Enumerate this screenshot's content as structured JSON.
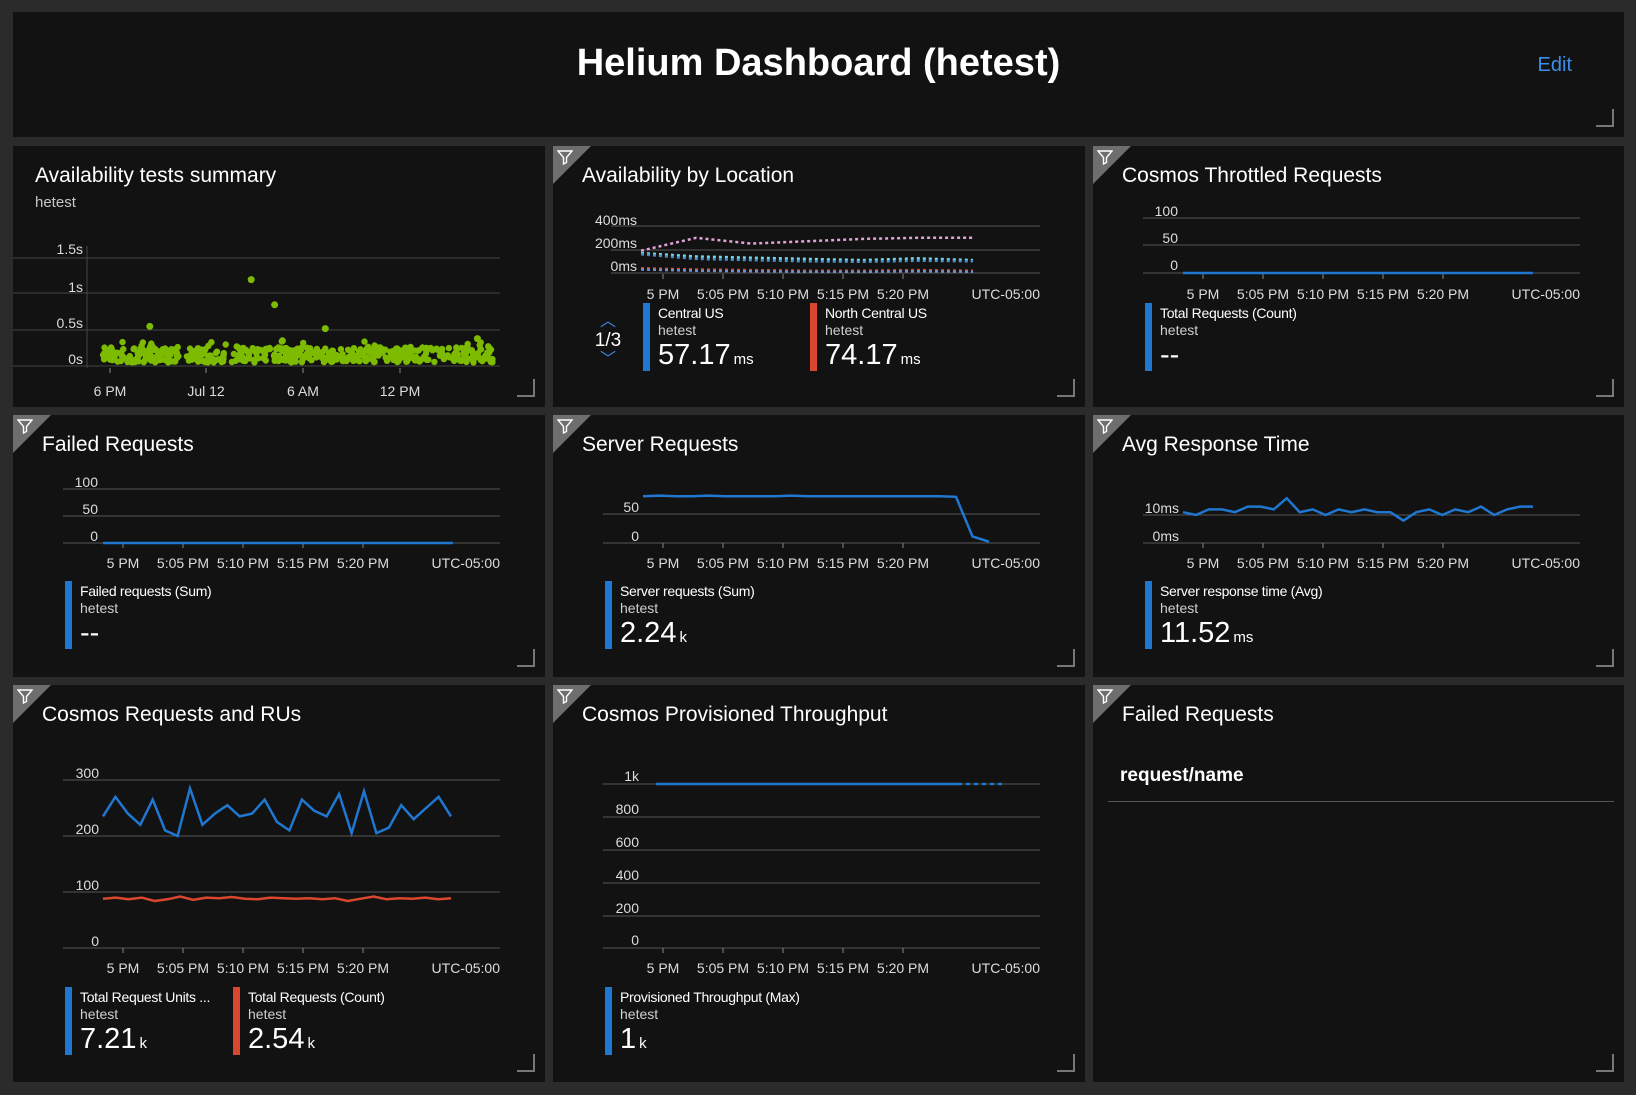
{
  "header": {
    "title": "Helium Dashboard (hetest)",
    "edit_label": "Edit"
  },
  "colors": {
    "blue": "#1f77d0",
    "red": "#d9472f",
    "green": "#7cbb00",
    "pink": "#e3a3d9",
    "cyan": "#6fd5e8",
    "accent_link": "#3b8eea"
  },
  "time_ticks": [
    "5 PM",
    "5:05 PM",
    "5:10 PM",
    "5:15 PM",
    "5:20 PM"
  ],
  "timezone": "UTC-05:00",
  "tiles": {
    "availability_summary": {
      "title": "Availability tests summary",
      "subtitle": "hetest",
      "y_ticks": [
        "1.5s",
        "1s",
        "0.5s",
        "0s"
      ],
      "x_ticks": [
        "6 PM",
        "Jul 12",
        "6 AM",
        "12 PM"
      ]
    },
    "availability_location": {
      "title": "Availability by Location",
      "y_ticks": [
        "400ms",
        "200ms",
        "0ms"
      ],
      "pager": "1/3",
      "legend": [
        {
          "name": "Central US",
          "resource": "hetest",
          "value": "57.17",
          "unit": "ms"
        },
        {
          "name": "North Central US",
          "resource": "hetest",
          "value": "74.17",
          "unit": "ms"
        }
      ]
    },
    "cosmos_throttled": {
      "title": "Cosmos Throttled Requests",
      "y_ticks": [
        "100",
        "50",
        "0"
      ],
      "legend": [
        {
          "name": "Total Requests (Count)",
          "resource": "hetest",
          "value": "--",
          "unit": ""
        }
      ]
    },
    "failed_requests_chart": {
      "title": "Failed Requests",
      "y_ticks": [
        "100",
        "50",
        "0"
      ],
      "legend": [
        {
          "name": "Failed requests (Sum)",
          "resource": "hetest",
          "value": "--",
          "unit": ""
        }
      ]
    },
    "server_requests": {
      "title": "Server Requests",
      "y_ticks": [
        "50",
        "0"
      ],
      "legend": [
        {
          "name": "Server requests (Sum)",
          "resource": "hetest",
          "value": "2.24",
          "unit": "k"
        }
      ]
    },
    "avg_response": {
      "title": "Avg Response Time",
      "y_ticks": [
        "10ms",
        "0ms"
      ],
      "legend": [
        {
          "name": "Server response time (Avg)",
          "resource": "hetest",
          "value": "11.52",
          "unit": "ms"
        }
      ]
    },
    "cosmos_rus": {
      "title": "Cosmos Requests and RUs",
      "y_ticks": [
        "300",
        "200",
        "100",
        "0"
      ],
      "legend": [
        {
          "name": "Total Request Units ...",
          "resource": "hetest",
          "value": "7.21",
          "unit": "k"
        },
        {
          "name": "Total Requests (Count)",
          "resource": "hetest",
          "value": "2.54",
          "unit": "k"
        }
      ]
    },
    "cosmos_throughput": {
      "title": "Cosmos Provisioned Throughput",
      "y_ticks": [
        "1k",
        "800",
        "600",
        "400",
        "200",
        "0"
      ],
      "legend": [
        {
          "name": "Provisioned Throughput (Max)",
          "resource": "hetest",
          "value": "1",
          "unit": "k"
        }
      ]
    },
    "failed_requests_grid": {
      "title": "Failed Requests",
      "column_header": "request/name"
    }
  },
  "chart_data": [
    {
      "type": "scatter",
      "id": "availability_summary",
      "x_ticks": [
        "6 PM",
        "Jul 12",
        "6 AM",
        "12 PM"
      ],
      "y_ticks": [
        "0s",
        "0.5s",
        "1s",
        "1.5s"
      ],
      "ylim": [
        0,
        1.5
      ],
      "outliers": [
        {
          "x": 0.12,
          "y": 0.55
        },
        {
          "x": 0.38,
          "y": 1.2
        },
        {
          "x": 0.44,
          "y": 0.85
        },
        {
          "x": 0.46,
          "y": 0.35
        },
        {
          "x": 0.57,
          "y": 0.52
        },
        {
          "x": 0.96,
          "y": 0.38
        }
      ],
      "band_y": [
        0.05,
        0.35
      ]
    },
    {
      "type": "line",
      "id": "availability_location",
      "x": [
        "5 PM",
        "5:05 PM",
        "5:10 PM",
        "5:15 PM",
        "5:20 PM"
      ],
      "ylim": [
        0,
        400
      ],
      "series": [
        {
          "values": [
            190,
            300,
            250,
            270,
            290,
            300,
            300
          ]
        },
        {
          "values": [
            170,
            140,
            130,
            120,
            110,
            125,
            110
          ]
        },
        {
          "values": [
            160,
            120,
            110,
            100,
            95,
            105,
            100
          ]
        },
        {
          "values": [
            40,
            30,
            25,
            20,
            20,
            25,
            20
          ]
        },
        {
          "values": [
            30,
            20,
            15,
            10,
            10,
            15,
            10
          ]
        }
      ]
    },
    {
      "type": "line",
      "id": "cosmos_throttled",
      "x": [
        "5 PM",
        "5:05 PM",
        "5:10 PM",
        "5:15 PM",
        "5:20 PM"
      ],
      "ylim": [
        0,
        100
      ],
      "series": [
        {
          "name": "Total Requests (Count)",
          "values": [
            0,
            0,
            0,
            0,
            0,
            0,
            0
          ]
        }
      ]
    },
    {
      "type": "line",
      "id": "failed_requests_chart",
      "x": [
        "5 PM",
        "5:05 PM",
        "5:10 PM",
        "5:15 PM",
        "5:20 PM"
      ],
      "ylim": [
        0,
        100
      ],
      "series": [
        {
          "name": "Failed requests (Sum)",
          "values": [
            0,
            0,
            0,
            0,
            0,
            0,
            0
          ]
        }
      ]
    },
    {
      "type": "line",
      "id": "server_requests",
      "x": [
        "5 PM",
        "5:05 PM",
        "5:10 PM",
        "5:15 PM",
        "5:20 PM"
      ],
      "ylim": [
        0,
        80
      ],
      "series": [
        {
          "name": "Server requests (Sum)",
          "values": [
            72,
            73,
            72,
            72,
            73,
            72,
            72,
            72,
            72,
            73,
            72,
            72,
            72,
            72,
            72,
            72,
            72,
            72,
            72,
            71,
            10,
            2
          ]
        }
      ]
    },
    {
      "type": "line",
      "id": "avg_response",
      "x": [
        "5 PM",
        "5:05 PM",
        "5:10 PM",
        "5:15 PM",
        "5:20 PM"
      ],
      "ylim": [
        0,
        20
      ],
      "series": [
        {
          "name": "Server response time (Avg)",
          "values": [
            11,
            10,
            12,
            12,
            11,
            13,
            13,
            12,
            16,
            11,
            12,
            10,
            12,
            11,
            12,
            11,
            11,
            8,
            11,
            12,
            10,
            12,
            11,
            13,
            10,
            12,
            13,
            13
          ]
        }
      ]
    },
    {
      "type": "line",
      "id": "cosmos_rus",
      "x": [
        "5 PM",
        "5:05 PM",
        "5:10 PM",
        "5:15 PM",
        "5:20 PM"
      ],
      "ylim": [
        0,
        300
      ],
      "series": [
        {
          "name": "Total Request Units ...",
          "values": [
            235,
            270,
            240,
            220,
            265,
            210,
            200,
            285,
            220,
            240,
            255,
            235,
            240,
            265,
            225,
            210,
            265,
            245,
            235,
            275,
            205,
            280,
            205,
            215,
            255,
            230,
            250,
            270,
            235
          ]
        },
        {
          "name": "Total Requests (Count)",
          "values": [
            88,
            90,
            87,
            90,
            84,
            87,
            92,
            86,
            90,
            89,
            91,
            88,
            87,
            90,
            89,
            88,
            89,
            87,
            89,
            84,
            88,
            92,
            87,
            89,
            88,
            90,
            87,
            89
          ]
        }
      ]
    },
    {
      "type": "line",
      "id": "cosmos_throughput",
      "x": [
        "5 PM",
        "5:05 PM",
        "5:10 PM",
        "5:15 PM",
        "5:20 PM"
      ],
      "ylim": [
        0,
        1000
      ],
      "series": [
        {
          "name": "Provisioned Throughput (Max)",
          "values": [
            1000,
            1000,
            1000,
            1000,
            1000,
            1000,
            1000
          ]
        }
      ]
    }
  ]
}
